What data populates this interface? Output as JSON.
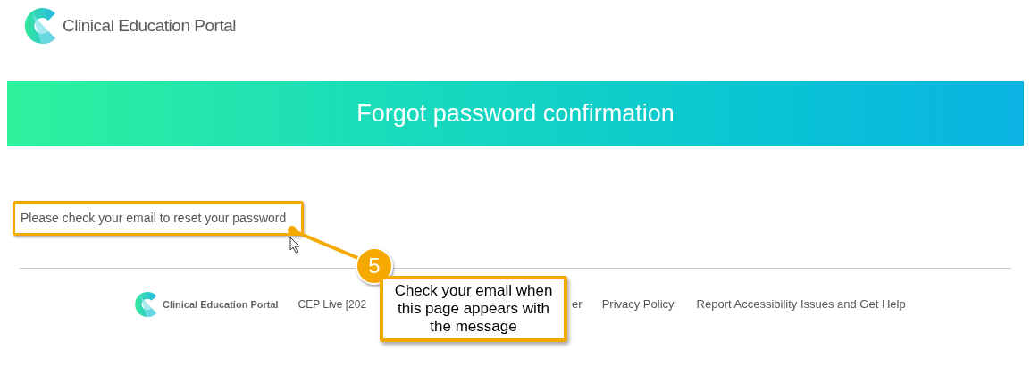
{
  "header": {
    "logo_text": "Clinical Education Portal"
  },
  "banner": {
    "title": "Forgot password confirmation"
  },
  "message": "Please check your email to reset your password",
  "footer": {
    "logo_text": "Clinical Education Portal",
    "links": [
      "CEP Live [202",
      "er",
      "Privacy Policy",
      "Report Accessibility Issues and Get Help"
    ]
  },
  "annotation": {
    "step": "5",
    "text": "Check your email when this page appears with the message"
  }
}
